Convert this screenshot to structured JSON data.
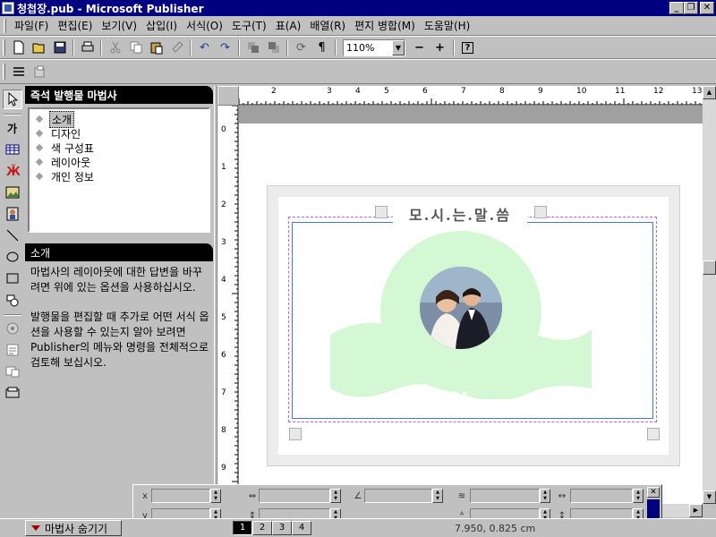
{
  "window": {
    "title": "청첩장.pub - Microsoft Publisher"
  },
  "menu": [
    "파일(F)",
    "편집(E)",
    "보기(V)",
    "삽입(I)",
    "서식(O)",
    "도구(T)",
    "표(A)",
    "배열(R)",
    "편지 병합(M)",
    "도움말(H)"
  ],
  "toolbar": {
    "icons": [
      "new-icon",
      "open-icon",
      "save-icon",
      "print-icon",
      "cut-icon",
      "copy-icon",
      "paste-icon",
      "format-painter-icon",
      "undo-icon",
      "redo-icon",
      "bring-front-icon",
      "send-back-icon",
      "rotate-icon",
      "pilcrow-icon"
    ],
    "zoom": "110%",
    "zoom_out": "−",
    "zoom_in": "+",
    "help": "?"
  },
  "left_tools": {
    "text_tool_label": "가"
  },
  "wizard": {
    "title": "즉석 발행물 마법사",
    "items": [
      "소개",
      "디자인",
      "색 구성표",
      "레이아웃",
      "개인 정보"
    ],
    "selected_index": 0,
    "section_title": "소개",
    "desc_p1": "마법사의 레이아웃에 대한 답변을 바꾸려면 위에 있는 옵션을 사용하십시오.",
    "desc_p2": "발행물을 편집할 때 추가로 어떤 서식 옵션을 사용할 수 있는지 알아 보려면 Publisher의 메뉴와 명령을 전체적으로 검토해 보십시오."
  },
  "ruler": {
    "h_labels": [
      "2",
      "3",
      "4",
      "5",
      "6",
      "7",
      "8",
      "9",
      "10",
      "11",
      "12",
      "13"
    ],
    "v_labels": [
      "0",
      "1",
      "2",
      "3",
      "4",
      "5",
      "6",
      "7",
      "8",
      "9"
    ]
  },
  "card": {
    "title": "모.시.는.말.씀"
  },
  "colors": {
    "card_green": "#d4f8d4",
    "title_blue": "#000080"
  },
  "measurement": {
    "x_label": "x",
    "y_label": "y",
    "close": "✕"
  },
  "status": {
    "hide_wizard": "마법사 숨기기",
    "pages": [
      "1",
      "2",
      "3",
      "4"
    ],
    "active_page": "1",
    "coords": "7.950, 0.825 cm"
  }
}
